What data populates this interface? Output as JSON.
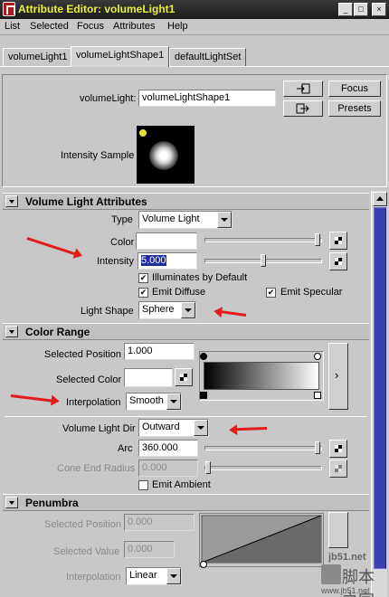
{
  "window": {
    "title": "Attribute Editor: volumeLight1",
    "controls": [
      "_",
      "□",
      "×"
    ]
  },
  "menu": [
    "List",
    "Selected",
    "Focus",
    "Attributes",
    "Help"
  ],
  "tabs": [
    {
      "label": "volumeLight1",
      "active": false
    },
    {
      "label": "volumeLightShape1",
      "active": true
    },
    {
      "label": "defaultLightSet",
      "active": false
    }
  ],
  "header": {
    "node_label": "volumeLight:",
    "node_value": "volumeLightShape1",
    "focus_label": "Focus",
    "presets_label": "Presets",
    "intensity_sample_label": "Intensity Sample"
  },
  "volume_light": {
    "section_title": "Volume Light Attributes",
    "type_label": "Type",
    "type_value": "Volume Light",
    "color_label": "Color",
    "intensity_label": "Intensity",
    "intensity_value": "5.000",
    "illuminates_label": "Illuminates by Default",
    "emit_diffuse_label": "Emit Diffuse",
    "emit_specular_label": "Emit Specular",
    "light_shape_label": "Light Shape",
    "light_shape_value": "Sphere"
  },
  "color_range": {
    "section_title": "Color Range",
    "selected_position_label": "Selected Position",
    "selected_position_value": "1.000",
    "selected_color_label": "Selected Color",
    "interpolation_label": "Interpolation",
    "interpolation_value": "Smooth",
    "volume_light_dir_label": "Volume Light Dir",
    "volume_light_dir_value": "Outward",
    "arc_label": "Arc",
    "arc_value": "360.000",
    "cone_end_radius_label": "Cone End Radius",
    "cone_end_radius_value": "0.000",
    "emit_ambient_label": "Emit Ambient",
    "expand_symbol": "›"
  },
  "penumbra": {
    "section_title": "Penumbra",
    "selected_position_label": "Selected Position",
    "selected_position_value": "0.000",
    "selected_value_label": "Selected Value",
    "selected_value_value": "0.000",
    "interpolation_label": "Interpolation",
    "interpolation_value": "Linear"
  },
  "watermark": {
    "url": "jb51.net",
    "text": "脚本之家",
    "sub": "www.jb51.net"
  },
  "colors": {
    "title_text": "#e8f03a",
    "annotation_arrow": "#e31b1b",
    "scroll_thumb": "#3b3fb0"
  }
}
